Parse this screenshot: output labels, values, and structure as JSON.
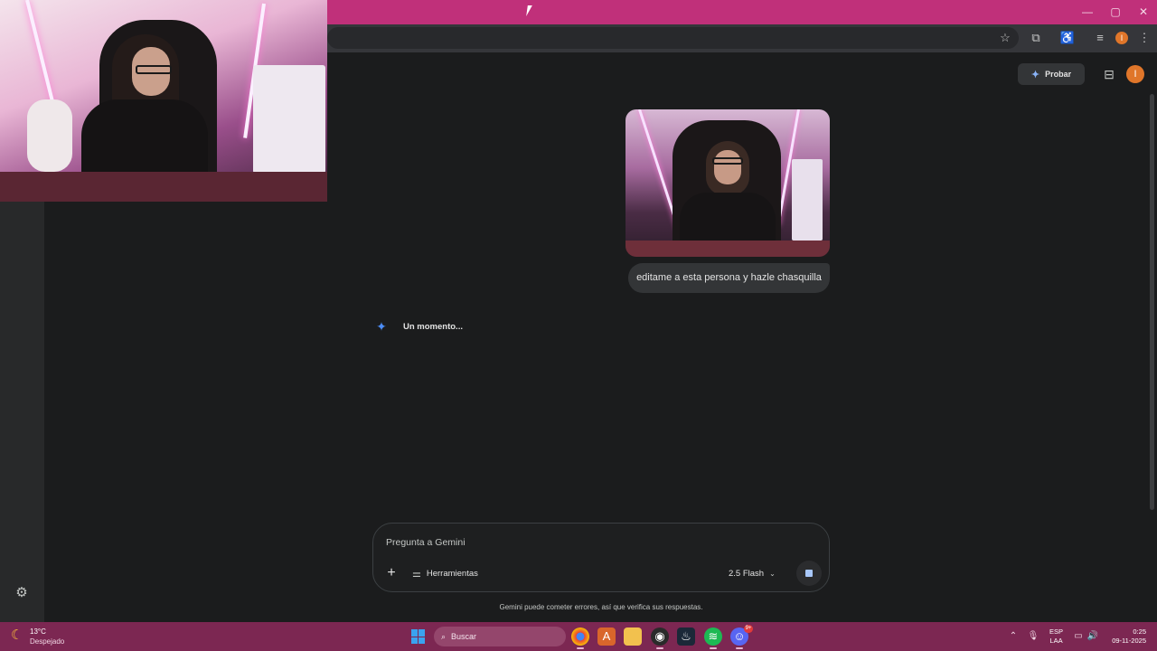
{
  "browser": {
    "window_controls": [
      "—",
      "▢",
      "✕"
    ],
    "toolbar_icons": [
      "star-icon",
      "extensions-icon",
      "accessibility-icon",
      "reading-list-icon",
      "menu-icon"
    ],
    "profile_initial": "I"
  },
  "gemini": {
    "top_bar": {
      "try_button": "Probar",
      "account_initial": "I"
    },
    "conversation": {
      "user_message": "editame a esta persona y hazle chasquilla",
      "model_status": "Un momento..."
    },
    "prompt": {
      "placeholder": "Pregunta a Gemini",
      "tools_label": "Herramientas",
      "model_label": "2.5 Flash"
    },
    "disclaimer": "Gemini puede cometer errores, así que verifica sus respuestas."
  },
  "taskbar": {
    "weather": {
      "temperature": "13°C",
      "condition": "Despejado"
    },
    "search_label": "Buscar",
    "apps": [
      "chrome-icon",
      "app-a-icon",
      "file-explorer-icon",
      "obs-icon",
      "steam-icon",
      "spotify-icon",
      "discord-icon"
    ],
    "discord_badge": "9+",
    "language": {
      "line1": "ESP",
      "line2": "LAA"
    },
    "clock": {
      "time": "0:25",
      "date": "09-11-2025"
    }
  },
  "colors": {
    "titlebar": "#c0307a",
    "taskbar": "#7c2752",
    "app_background": "#1b1c1d",
    "accent_blue": "#4c8df6",
    "avatar_orange": "#e0762a"
  }
}
